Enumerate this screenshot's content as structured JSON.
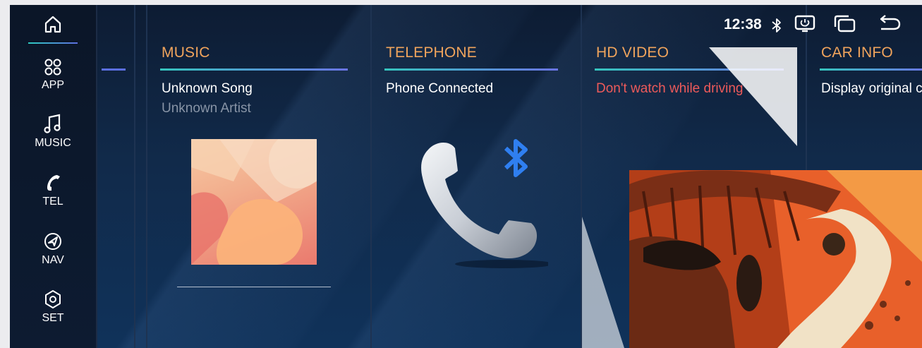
{
  "status_bar": {
    "time": "12:38"
  },
  "sidebar": {
    "items": [
      {
        "label": "APP"
      },
      {
        "label": "MUSIC"
      },
      {
        "label": "TEL"
      },
      {
        "label": "NAV"
      },
      {
        "label": "SET"
      }
    ]
  },
  "cards": {
    "music": {
      "title": "MUSIC",
      "song": "Unknown Song",
      "artist": "Unknown Artist"
    },
    "telephone": {
      "title": "TELEPHONE",
      "status": "Phone Connected"
    },
    "hd_video": {
      "title": "HD VIDEO",
      "warning": "Don't watch while driving"
    },
    "car_info": {
      "title": "CAR INFO",
      "subtitle": "Display original c"
    }
  },
  "colors": {
    "accent_title": "#f0a45c",
    "warning": "#ee5a5a",
    "bluetooth": "#2f7ff0"
  }
}
